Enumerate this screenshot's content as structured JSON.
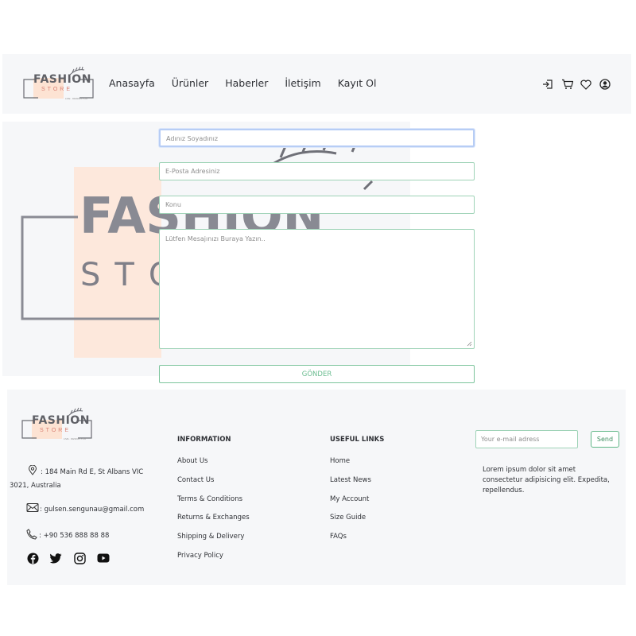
{
  "logo": {
    "brand": "FASHION",
    "store": "STORE",
    "tagline": "LIVE · DESIGN·YOU"
  },
  "nav": {
    "links": [
      "Anasayfa",
      "Ürünler",
      "Haberler",
      "İletişim",
      "Kayıt Ol"
    ],
    "icons": [
      "login-icon",
      "cart-icon",
      "heart-icon",
      "user-icon"
    ]
  },
  "hero": {
    "brand": "FASHION",
    "store": "STORE"
  },
  "form": {
    "name_placeholder": "Adınız Soyadınız",
    "email_placeholder": "E-Posta Adresiniz",
    "subject_placeholder": "Konu",
    "message_placeholder": "Lütfen Mesajınızı Buraya Yazın..",
    "submit_label": "GÖNDER"
  },
  "footer": {
    "address_line1": ": 184 Main Rd E, St Albans VIC",
    "address_line2": "3021, Australia",
    "email": ": gulsen.sengunau@gmail.com",
    "phone": ": +90 536 888 88 88",
    "information": {
      "heading": "INFORMATION",
      "links": [
        "About Us",
        "Contact Us",
        "Terms & Conditions",
        "Returns & Exchanges",
        "Shipping & Delivery",
        "Privacy Policy"
      ]
    },
    "useful": {
      "heading": "USEFUL LINKS",
      "links": [
        "Home",
        "Latest News",
        "My Account",
        "Size Guide",
        "FAQs"
      ]
    },
    "newsletter_placeholder": "Your e-mail adress",
    "send_label": "Send",
    "lorem": "Lorem ipsum dolor sit amet consectetur adipisicing elit. Expedita, repellendus.",
    "social": [
      "facebook-icon",
      "twitter-icon",
      "instagram-icon",
      "youtube-icon"
    ]
  },
  "colors": {
    "accent": "#6cbd91",
    "peach": "#fde3d3",
    "background": "#f6f7f9"
  }
}
